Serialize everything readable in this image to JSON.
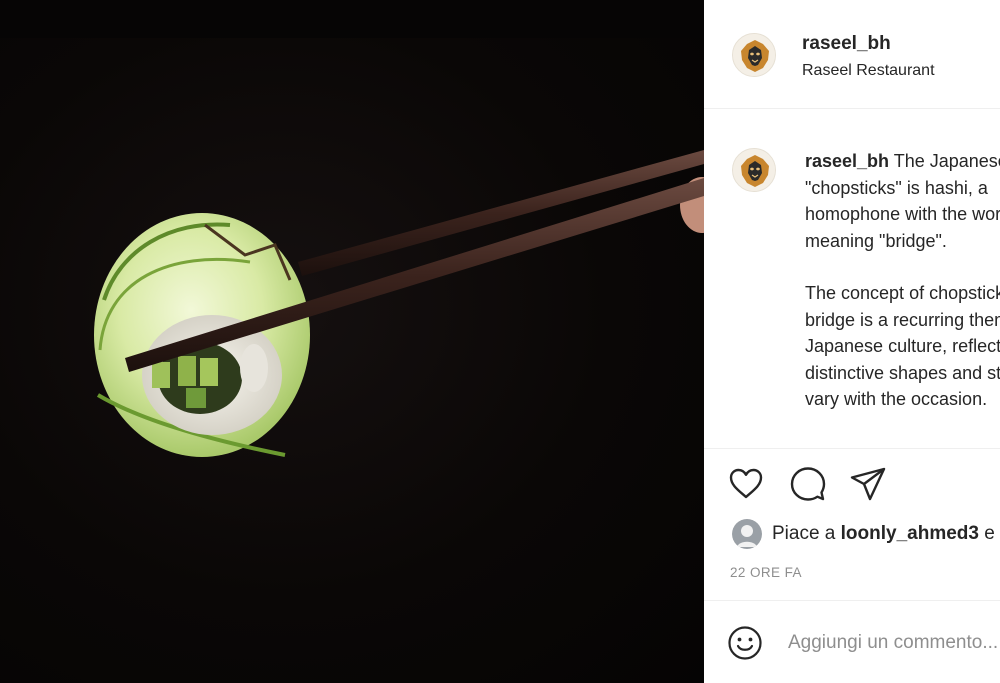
{
  "post": {
    "image_alt": "Sushi roll held with chopsticks",
    "author": {
      "username": "raseel_bh",
      "location": "Raseel Restaurant",
      "avatar_icon": "lion-logo-icon"
    },
    "caption": {
      "username": "raseel_bh",
      "lines_p1": [
        " The Japanese word for",
        "\"chopsticks\" is hashi, a",
        "homophone with the word",
        "meaning \"bridge\"."
      ],
      "lines_p2": [
        "The concept of chopsticks as a",
        "bridge is a recurring theme in",
        "Japanese culture, reflected in",
        "distinctive shapes and styles that",
        "vary with the occasion."
      ]
    },
    "actions": {
      "like_icon": "heart-icon",
      "comment_icon": "comment-icon",
      "share_icon": "send-icon"
    },
    "likes": {
      "prefix": "Piace a ",
      "username": "loonly_ahmed3",
      "suffix": " e altri"
    },
    "timestamp": "22 ORE FA",
    "comment_box": {
      "placeholder": "Aggiungi un commento...",
      "emoji_icon": "emoji-icon"
    }
  },
  "colors": {
    "text": "#262626",
    "muted": "#8e8e8e",
    "border": "#efefef",
    "photo_bg": "#070505"
  }
}
